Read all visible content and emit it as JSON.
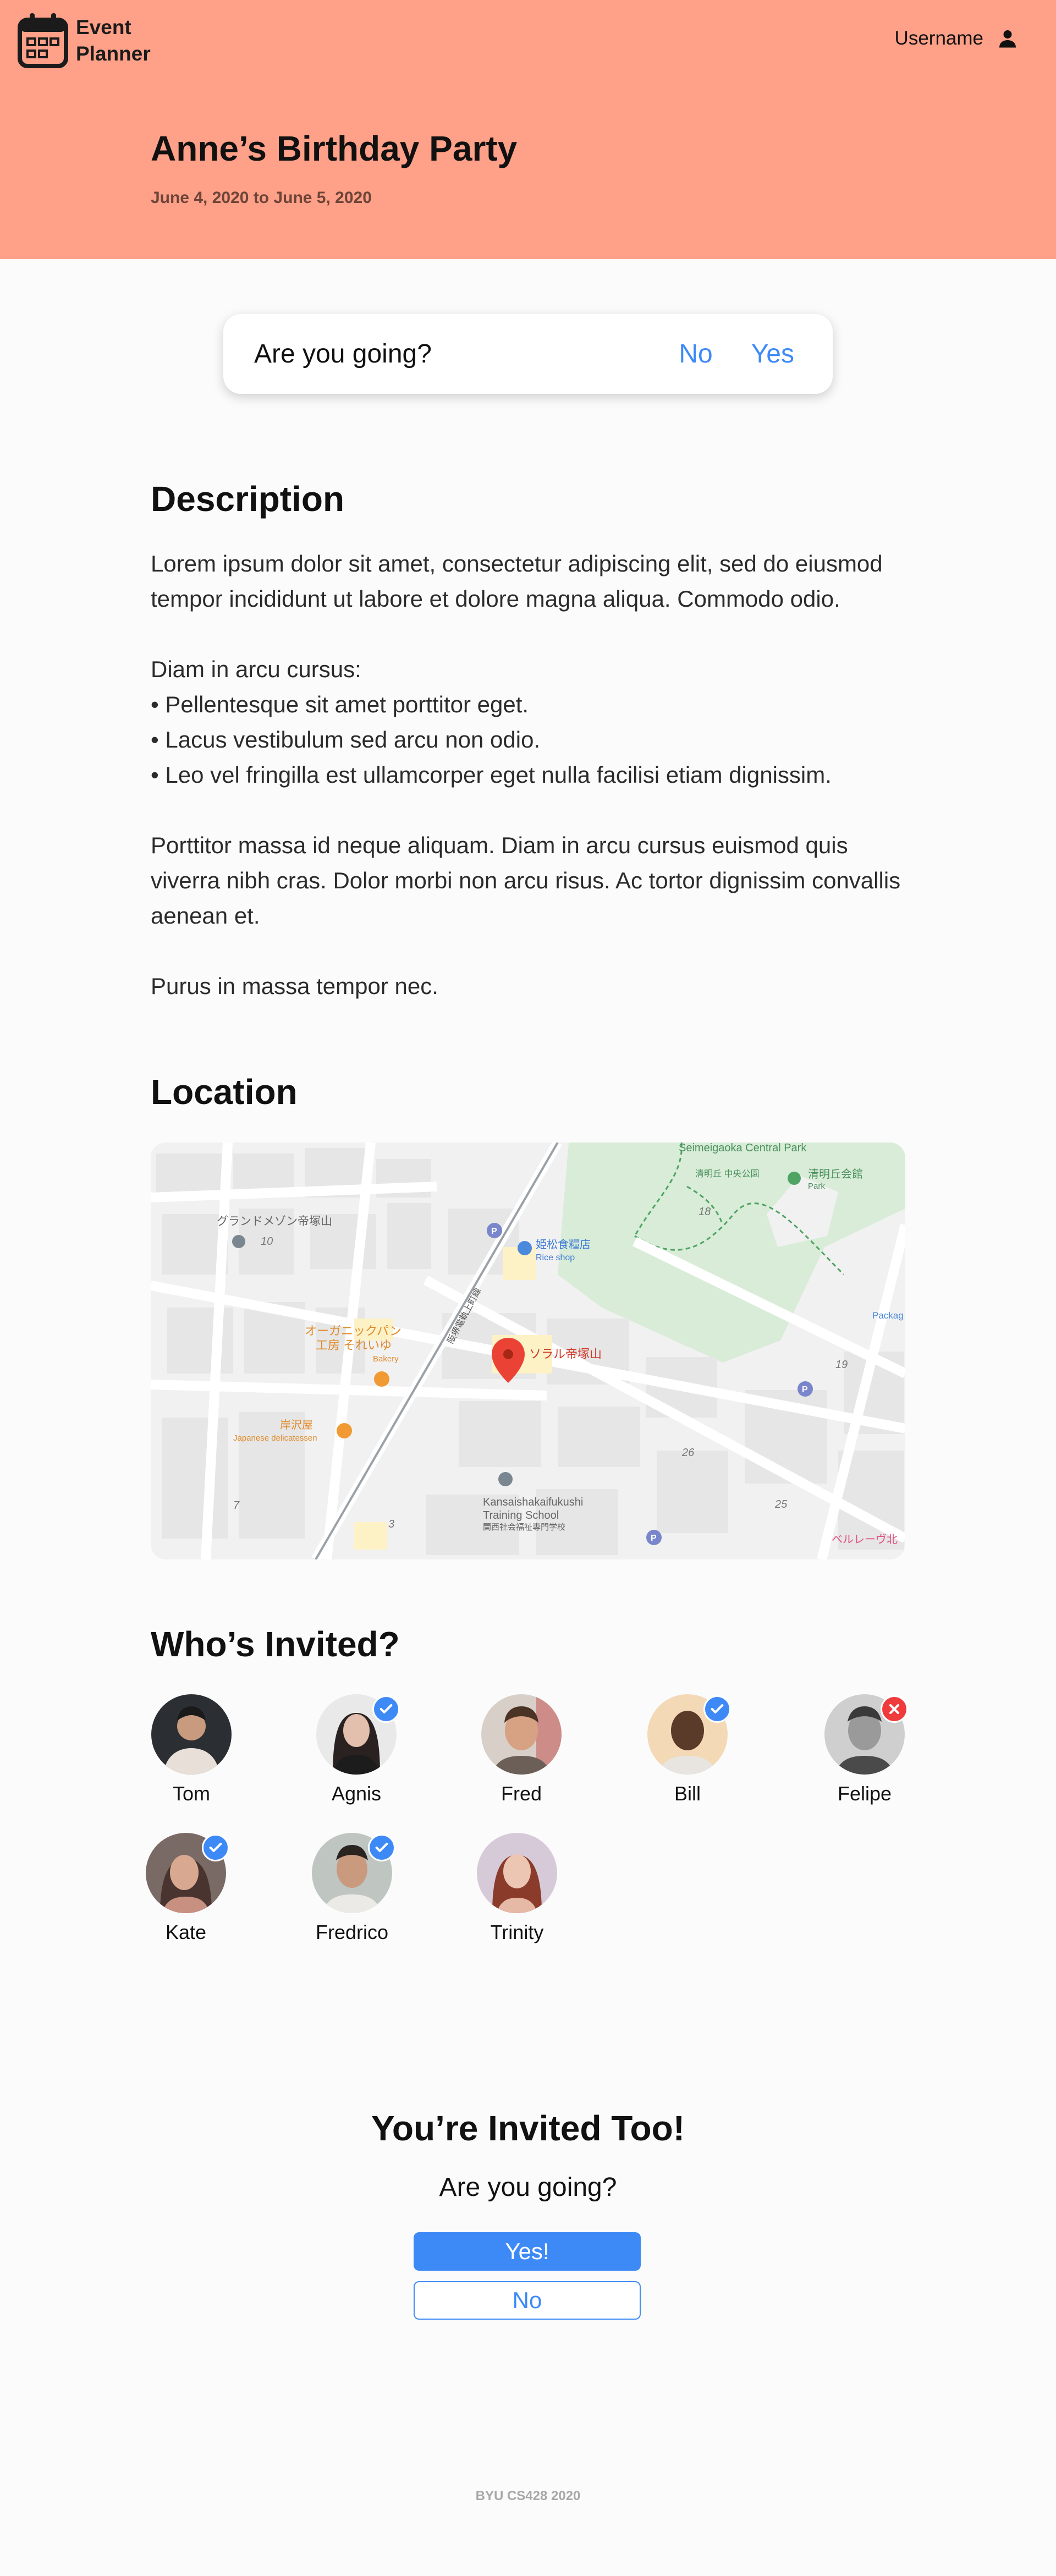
{
  "app": {
    "name_line1": "Event",
    "name_line2": "Planner"
  },
  "header": {
    "username": "Username"
  },
  "event": {
    "title": "Anne’s Birthday Party",
    "dates": "June 4, 2020 to June 5, 2020"
  },
  "rsvp": {
    "question": "Are you going?",
    "no_label": "No",
    "yes_label": "Yes"
  },
  "description": {
    "heading": "Description",
    "para1": "Lorem ipsum dolor sit amet, consectetur adipiscing elit, sed do eiusmod tempor incididunt ut labore et dolore magna aliqua. Commodo odio.",
    "list_intro": "Diam in arcu cursus:",
    "bullets": [
      "• Pellentesque sit amet porttitor eget.",
      "• Lacus vestibulum sed arcu non odio.",
      "• Leo vel fringilla est ullamcorper eget nulla facilisi etiam dignissim."
    ],
    "para3": "Porttitor massa id neque aliquam. Diam in arcu cursus euismod quis viverra nibh cras. Dolor morbi non arcu risus. Ac tortor dignissim convallis aenean et.",
    "para4": "Purus in massa tempor nec."
  },
  "location": {
    "heading": "Location",
    "map_labels": {
      "park": "Seimeigaoka Central Park",
      "park_jp": "清明丘 中央公園",
      "hall": "清明丘会館",
      "hall_sub": "Park",
      "mansion": "グランドメゾン帝塚山",
      "rice_shop": "姫松食糧店",
      "rice_shop_en": "Rice shop",
      "bakery_jp1": "オーガニックパン",
      "bakery_jp2": "工房 それいゆ",
      "bakery_en": "Bakery",
      "pin_label": "ソラル帝塚山",
      "deli_jp": "岸沢屋",
      "deli_en": "Japanese delicatessen",
      "school1": "Kansaishakaifukushi",
      "school2": "Training School",
      "school_jp": "関西社会福祉専門学校",
      "road": "阪堺電軌上町線",
      "package": "Packag",
      "bottom_right": "ベルレーヴ北",
      "n10": "10",
      "n18": "18",
      "n19": "19",
      "n26": "26",
      "n25": "25",
      "n7": "7",
      "n3": "3"
    }
  },
  "invitees": {
    "heading": "Who’s Invited?",
    "people": [
      {
        "name": "Tom",
        "status": "none"
      },
      {
        "name": "Agnis",
        "status": "yes"
      },
      {
        "name": "Fred",
        "status": "none"
      },
      {
        "name": "Bill",
        "status": "yes"
      },
      {
        "name": "Felipe",
        "status": "no"
      },
      {
        "name": "Kate",
        "status": "yes"
      },
      {
        "name": "Fredrico",
        "status": "yes"
      },
      {
        "name": "Trinity",
        "status": "none"
      }
    ]
  },
  "invite_you": {
    "title": "You’re Invited Too!",
    "question": "Are you going?",
    "yes_label": "Yes!",
    "no_label": "No"
  },
  "footer": {
    "text": "BYU CS428 2020"
  },
  "colors": {
    "header_bg": "#ffa088",
    "accent": "#3d8af7",
    "decline": "#ef3b3b",
    "dates_text": "#6d4538"
  },
  "icons": [
    "calendar-icon",
    "user-icon",
    "check-icon",
    "map-pin-icon"
  ]
}
